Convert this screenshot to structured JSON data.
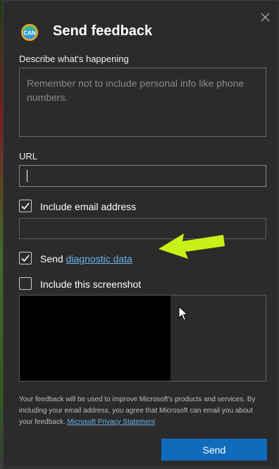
{
  "dialog": {
    "title": "Send feedback",
    "close_icon": "close-icon",
    "logo_icon": "logo-icon",
    "logo_text": "CAN"
  },
  "describe": {
    "label": "Describe what's happening",
    "placeholder": "Remember not to include personal info like phone numbers."
  },
  "url": {
    "label": "URL",
    "value": ""
  },
  "email": {
    "checkbox_label": "Include email address",
    "checked": true,
    "value": ""
  },
  "diagnostic": {
    "label_prefix": "Send",
    "link_text": "diagnostic data",
    "checked": true
  },
  "screenshot": {
    "checkbox_label": "Include this screenshot",
    "checked": false
  },
  "footer": {
    "text": "Your feedback will be used to improve Microsoft's products and services. By including your email address, you agree that Microsoft can email you about your feedback.",
    "link_text": "Microsoft Privacy Statement"
  },
  "send_button": {
    "label": "Send"
  },
  "colors": {
    "background": "#2b2b2b",
    "accent": "#0f6cbd",
    "link": "#6cb2ee",
    "annotation_arrow": "#c8f018"
  }
}
